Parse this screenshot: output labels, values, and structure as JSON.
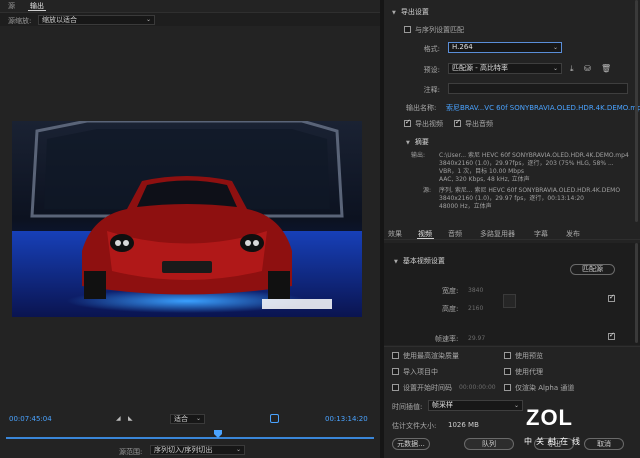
{
  "left_panel": {
    "tabs": [
      "源",
      "输出"
    ],
    "source_scaling": {
      "label": "源缩放:",
      "value": "缩放以适合"
    },
    "timecode_in": "00:07:45:04",
    "timecode_out": "00:13:14:20",
    "fit": "适合",
    "source_range": {
      "label": "源范围:",
      "value": "序列切入/序列切出"
    }
  },
  "export_settings": {
    "header": "导出设置",
    "match_sequence": {
      "label": "与序列设置匹配",
      "checked": false
    },
    "format": {
      "label": "格式:",
      "value": "H.264"
    },
    "preset": {
      "label": "预设:",
      "value": "匹配源 - 高比特率"
    },
    "comments": {
      "label": "注释:",
      "value": ""
    },
    "output_name": {
      "label": "输出名称:",
      "value": "索尼BRAV...VC 60f SONYBRAVIA.OLED.HDR.4K.DEMO.mp4"
    },
    "export_video": {
      "label": "导出视频",
      "checked": true
    },
    "export_audio": {
      "label": "导出音频",
      "checked": true
    },
    "summary": {
      "header": "摘要",
      "output_label": "输出:",
      "output_lines": [
        "C:\\User... 索尼 HEVC 60f SONYBRAVIA.OLED.HDR.4K.DEMO.mp4",
        "3840x2160 (1.0)，29.97fps，逐行，203 (75% HLG, 58% ...",
        "VBR，1 次，目标 10.00 Mbps",
        "AAC, 320 Kbps, 48  kHz, 立体声"
      ],
      "source_label": "源:",
      "source_lines": [
        "序列, 索尼... 索尼 HEVC 60f SONYBRAVIA.OLED.HDR.4K.DEMO",
        "3840x2160 (1.0)，29.97 fps，逐行，00:13:14:20",
        "48000 Hz，立体声"
      ]
    }
  },
  "tabs": [
    "效果",
    "视频",
    "音频",
    "多路复用器",
    "字幕",
    "发布"
  ],
  "active_tab": "视频",
  "basic_video": {
    "header": "基本视频设置",
    "match_source_button": "匹配源",
    "width": {
      "label": "宽度:",
      "value": "3840"
    },
    "height": {
      "label": "高度:",
      "value": "2160"
    },
    "frame_rate": {
      "label": "帧速率:",
      "value": "29.97"
    }
  },
  "options": {
    "max_render_quality": "使用最高渲染质量",
    "use_previews": "使用预览",
    "import_into_project": "导入项目中",
    "use_proxies": "使用代理",
    "set_start_timecode": "设置开始时间码",
    "start_timecode_value": "00:00:00:00",
    "render_alpha_only": "仅渲染 Alpha 通道",
    "time_interpolation": {
      "label": "时间插值:",
      "value": "帧采样"
    },
    "file_size": {
      "label": "估计文件大小:",
      "value": "1026 MB"
    }
  },
  "buttons": {
    "metadata": "元数据...",
    "queue": "队列",
    "export": "导出",
    "cancel": "取消"
  },
  "watermark": {
    "logo": "ZOL",
    "sub": "中关村在线"
  }
}
